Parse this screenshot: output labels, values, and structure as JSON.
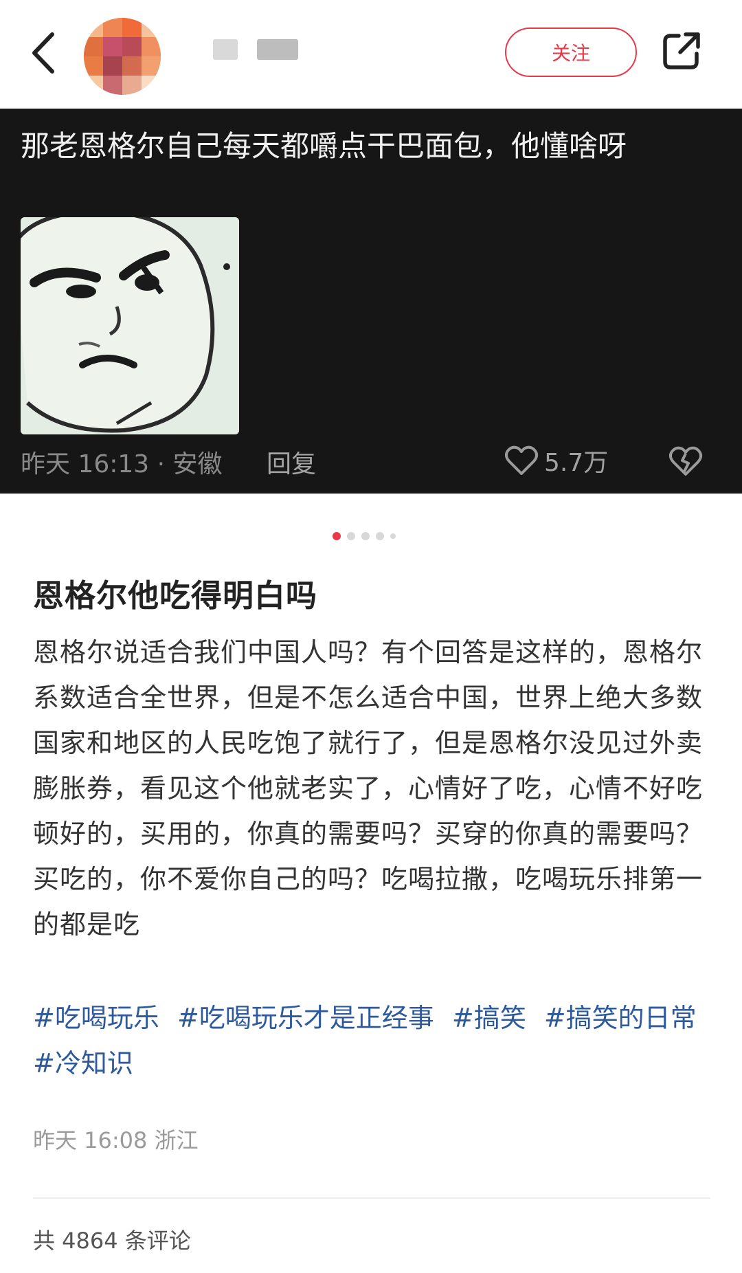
{
  "header": {
    "follow_label": "关注",
    "icons": {
      "back": "chevron-left-icon",
      "share": "share-external-icon"
    }
  },
  "comment_card": {
    "text": "那老恩格尔自己每天都嚼点干巴面包，他懂啥呀",
    "meta": "昨天 16:13 · 安徽",
    "reply_label": "回复",
    "likes": "5.7万",
    "icons": {
      "like": "heart-outline-icon",
      "dislike": "broken-heart-icon"
    }
  },
  "pager": {
    "count": 5,
    "active_index": 0
  },
  "post": {
    "title": "恩格尔他吃得明白吗",
    "body": "恩格尔说适合我们中国人吗？有个回答是这样的，恩格尔系数适合全世界，但是不怎么适合中国，世界上绝大多数国家和地区的人民吃饱了就行了，但是恩格尔没见过外卖膨胀券，看见这个他就老实了，心情好了吃，心情不好吃顿好的，买用的，你真的需要吗？买穿的你真的需要吗？买吃的，你不爱你自己的吗？吃喝拉撒，吃喝玩乐排第一的都是吃",
    "tags": [
      "#吃喝玩乐",
      "#吃喝玩乐才是正经事",
      "#搞笑",
      "#搞笑的日常",
      "#冷知识"
    ],
    "meta": "昨天 16:08 浙江",
    "comment_count": "共 4864 条评论"
  },
  "colors": {
    "accent": "#e8394a",
    "tag": "#2e5a9c",
    "card_bg": "#161616"
  }
}
